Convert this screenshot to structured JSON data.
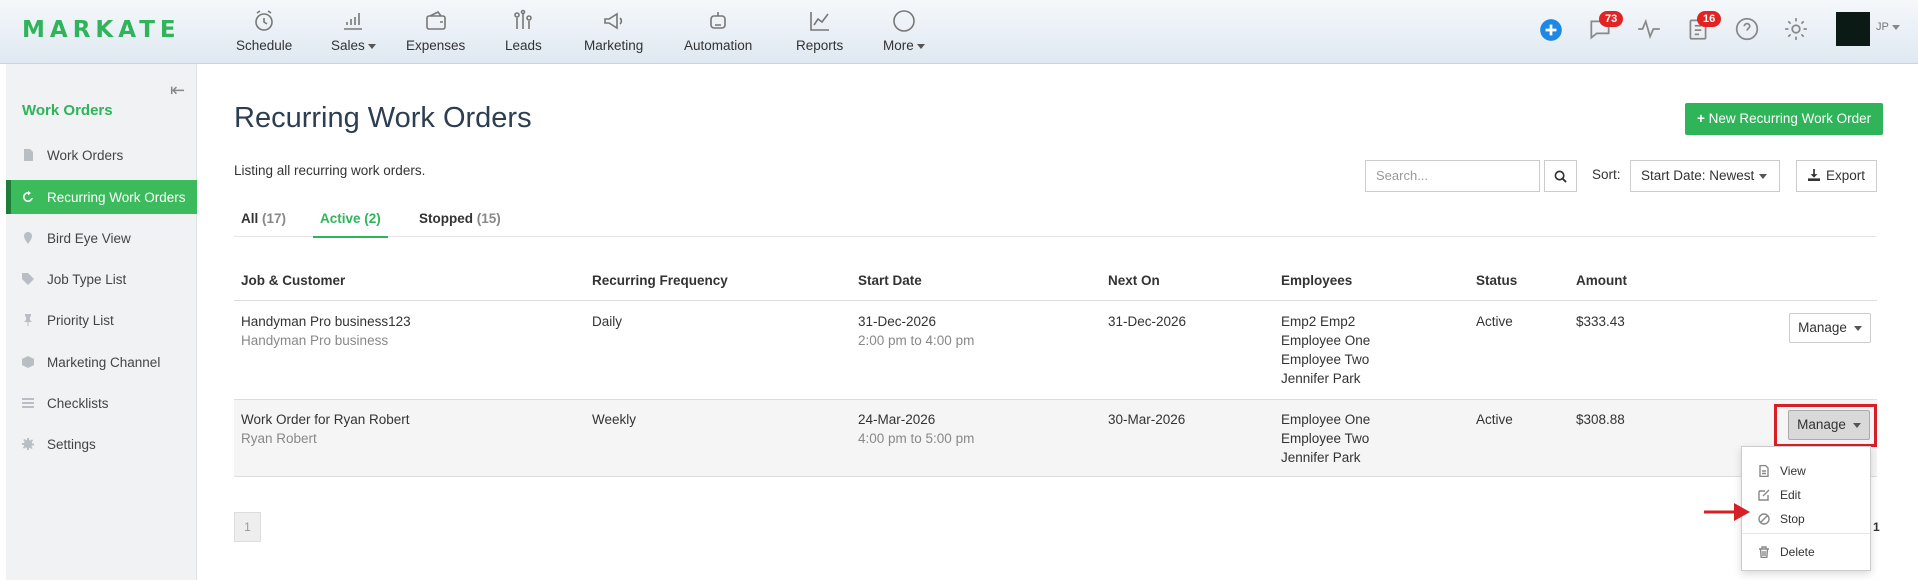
{
  "brand": {
    "logo": "MARKATE",
    "accent": "#2fb45a",
    "highlight": "#d61f26"
  },
  "topnav": {
    "items": [
      {
        "label": "Schedule",
        "icon": "alarm-clock-icon"
      },
      {
        "label": "Sales",
        "icon": "chart-hand-icon",
        "dropdown": true
      },
      {
        "label": "Expenses",
        "icon": "wallet-icon"
      },
      {
        "label": "Leads",
        "icon": "funnel-bars-icon"
      },
      {
        "label": "Marketing",
        "icon": "megaphone-icon"
      },
      {
        "label": "Automation",
        "icon": "robot-icon"
      },
      {
        "label": "Reports",
        "icon": "line-chart-icon"
      },
      {
        "label": "More",
        "icon": "ellipsis-circle-icon",
        "dropdown": true
      }
    ],
    "right": {
      "messages_count": "73",
      "tasks_count": "16",
      "user_initials": "JP"
    }
  },
  "sidebar": {
    "title": "Work Orders",
    "items": [
      {
        "label": "Work Orders",
        "icon": "document-icon"
      },
      {
        "label": "Recurring Work Orders",
        "icon": "refresh-icon",
        "active": true
      },
      {
        "label": "Bird Eye View",
        "icon": "map-pin-icon"
      },
      {
        "label": "Job Type List",
        "icon": "tag-icon"
      },
      {
        "label": "Priority List",
        "icon": "pushpin-icon"
      },
      {
        "label": "Marketing Channel",
        "icon": "cubes-icon"
      },
      {
        "label": "Checklists",
        "icon": "list-icon"
      },
      {
        "label": "Settings",
        "icon": "gear-icon"
      }
    ]
  },
  "main": {
    "title": "Recurring Work Orders",
    "new_button": "New Recurring Work Order",
    "subtitle": "Listing all recurring work orders.",
    "search_placeholder": "Search...",
    "sort_label": "Sort:",
    "sort_value": "Start Date: Newest",
    "export_label": "Export",
    "tabs": [
      {
        "label": "All",
        "count": "(17)"
      },
      {
        "label": "Active",
        "count": "(2)",
        "active": true
      },
      {
        "label": "Stopped",
        "count": "(15)"
      }
    ],
    "columns": [
      "Job & Customer",
      "Recurring Frequency",
      "Start Date",
      "Next On",
      "Employees",
      "Status",
      "Amount"
    ],
    "rows": [
      {
        "job": "Handyman Pro business123",
        "customer": "Handyman Pro business",
        "frequency": "Daily",
        "start_date": "31-Dec-2026",
        "start_time": "2:00 pm to 4:00 pm",
        "next_on": "31-Dec-2026",
        "employees": [
          "Emp2 Emp2",
          "Employee One",
          "Employee Two",
          "Jennifer Park"
        ],
        "status": "Active",
        "amount": "$333.43",
        "action": "Manage"
      },
      {
        "job": "Work Order for Ryan Robert",
        "customer": "Ryan Robert",
        "frequency": "Weekly",
        "start_date": "24-Mar-2026",
        "start_time": "4:00 pm to 5:00 pm",
        "next_on": "30-Mar-2026",
        "employees": [
          "Employee One",
          "Employee Two",
          "Jennifer Park"
        ],
        "status": "Active",
        "amount": "$308.88",
        "action": "Manage"
      }
    ],
    "manage_menu": [
      "View",
      "Edit",
      "Stop",
      "Delete"
    ],
    "pagination": {
      "current": "1",
      "edge": "1"
    }
  }
}
